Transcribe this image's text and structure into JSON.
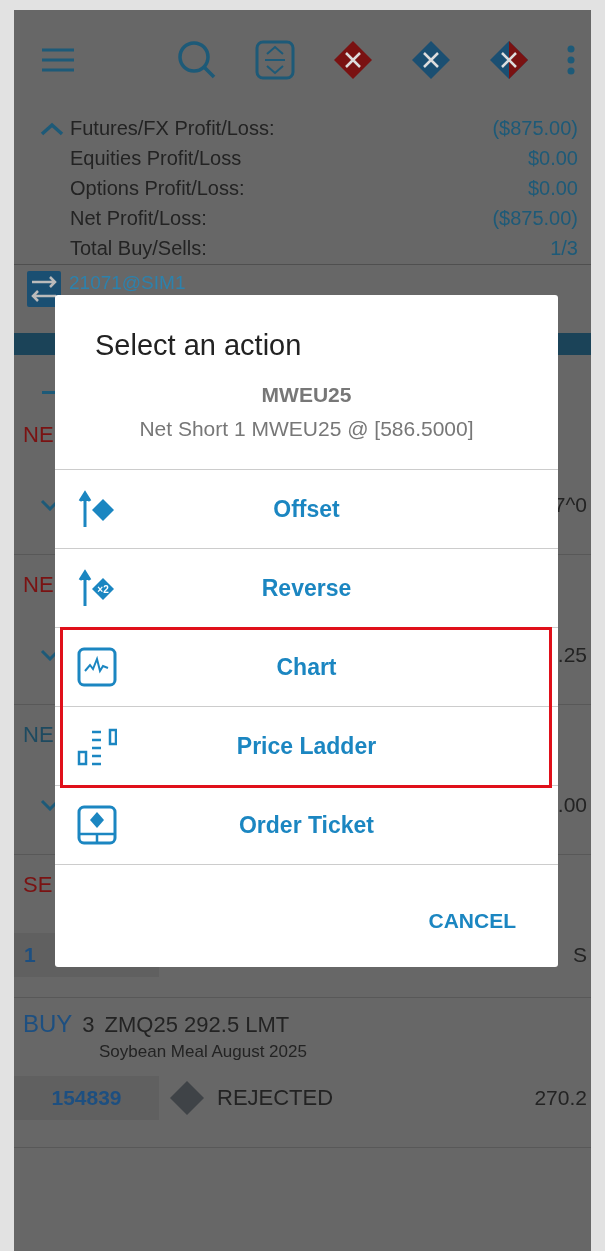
{
  "summary": {
    "expanded": true,
    "rows": [
      {
        "label": "Futures/FX Profit/Loss:",
        "value": "($875.00)"
      },
      {
        "label": "Equities Profit/Loss",
        "value": "$0.00"
      },
      {
        "label": "Options Profit/Loss:",
        "value": "$0.00"
      },
      {
        "label": "Net Profit/Loss:",
        "value": "($875.00)"
      },
      {
        "label": "Total Buy/Sells:",
        "value": "1/3"
      }
    ]
  },
  "account": "21071@SIM1",
  "positions": [
    {
      "label": "NE",
      "color": "#7a1212",
      "value": "7^0"
    },
    {
      "label": "NE",
      "color": "#7a1212",
      "value": ".25"
    },
    {
      "label": "NE",
      "color": "#1d4a60",
      "value": ".00"
    }
  ],
  "sell_order": {
    "side": "SE",
    "order_id": "1",
    "value": "S"
  },
  "buy_order": {
    "side": "BUY",
    "qty": "3",
    "contract": "ZMQ25 292.5 LMT",
    "description": "Soybean Meal August 2025",
    "order_id": "154839",
    "status": "REJECTED",
    "price": "270.2"
  },
  "dialog": {
    "title": "Select an action",
    "symbol": "MWEU25",
    "position": "Net Short 1 MWEU25 @ [586.5000]",
    "actions": [
      {
        "kind": "offset",
        "label": "Offset",
        "highlighted": false
      },
      {
        "kind": "reverse",
        "label": "Reverse",
        "badge": "×2",
        "highlighted": false
      },
      {
        "kind": "chart",
        "label": "Chart",
        "highlighted": true
      },
      {
        "kind": "ladder",
        "label": "Price Ladder",
        "highlighted": true
      },
      {
        "kind": "ticket",
        "label": "Order Ticket",
        "highlighted": false
      }
    ],
    "cancel": "CANCEL"
  }
}
